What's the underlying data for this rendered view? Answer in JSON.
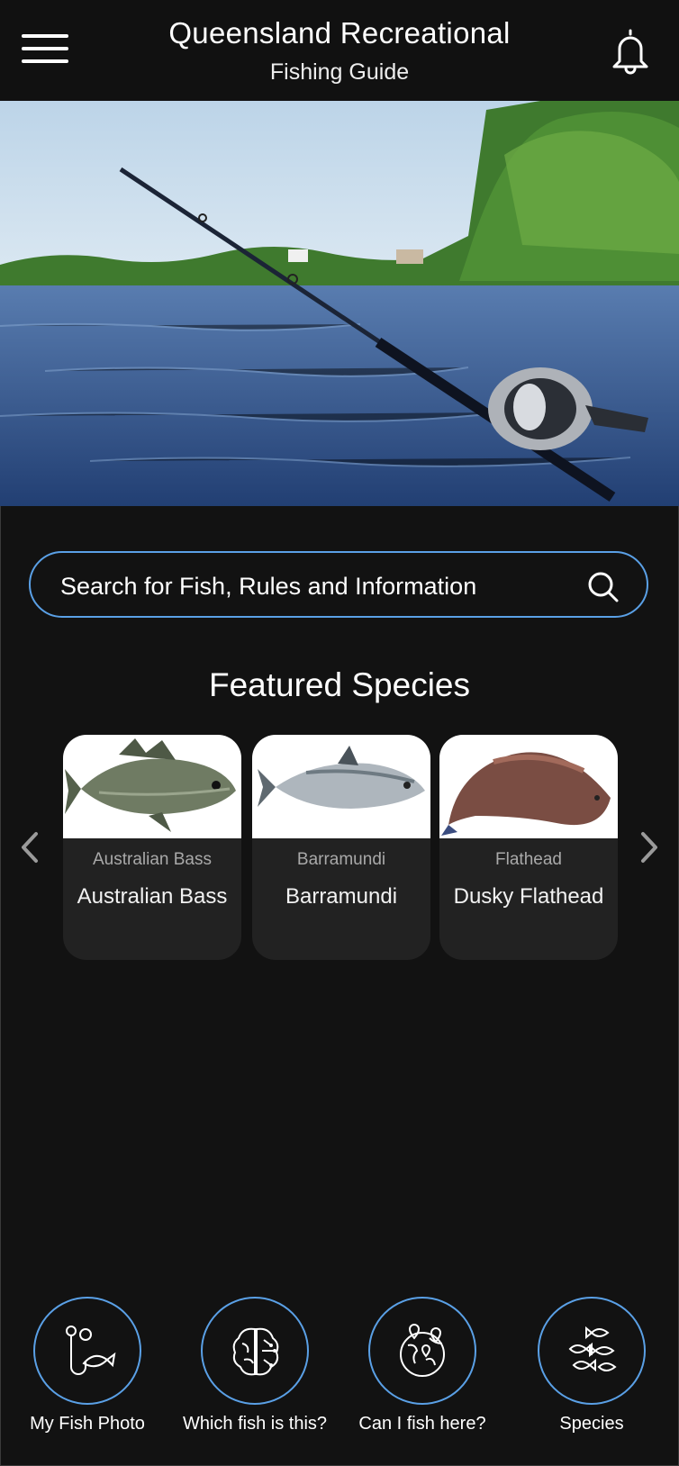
{
  "header": {
    "title": "Queensland Recreational",
    "subtitle": "Fishing Guide"
  },
  "search": {
    "placeholder": "Search for Fish, Rules and Information"
  },
  "featured": {
    "heading": "Featured Species",
    "cards": [
      {
        "category": "Australian Bass",
        "name": "Australian Bass"
      },
      {
        "category": "Barramundi",
        "name": "Barramundi"
      },
      {
        "category": "Flathead",
        "name": "Dusky Flathead"
      }
    ]
  },
  "bottom_nav": [
    {
      "label": "My Fish Photo",
      "icon": "fish-hook-icon"
    },
    {
      "label": "Which fish is this?",
      "icon": "brain-icon"
    },
    {
      "label": "Can I fish here?",
      "icon": "globe-pins-icon"
    },
    {
      "label": "Species",
      "icon": "fish-school-icon"
    }
  ],
  "colors": {
    "background": "#121212",
    "accent": "#5aa0e6",
    "card": "#222222"
  }
}
